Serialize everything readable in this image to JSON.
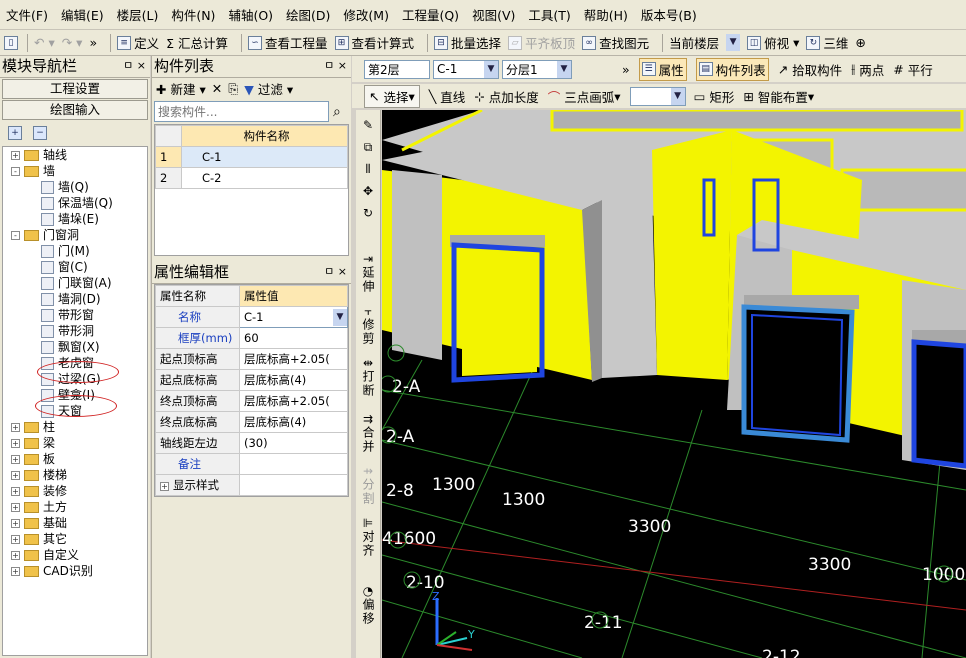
{
  "menu": [
    "文件(F)",
    "编辑(E)",
    "楼层(L)",
    "构件(N)",
    "辅轴(O)",
    "绘图(D)",
    "修改(M)",
    "工程量(Q)",
    "视图(V)",
    "工具(T)",
    "帮助(H)",
    "版本号(B)"
  ],
  "toolbar": {
    "define": "定义",
    "summary": "Σ 汇总计算",
    "view_qty": "查看工程量",
    "view_formula": "查看计算式",
    "batch_select": "批量选择",
    "align_slab": "平齐板顶",
    "find_elem": "查找图元",
    "cur_floor": "当前楼层",
    "view_mode": "俯视",
    "view_3d": "三维"
  },
  "nav": {
    "title": "模块导航栏",
    "pin": "ㅁ ×",
    "btn1": "工程设置",
    "btn2": "绘图输入",
    "tree": [
      {
        "label": "轴线",
        "level": 0,
        "type": "folder",
        "pm": "+"
      },
      {
        "label": "墙",
        "level": 0,
        "type": "folder",
        "pm": "-"
      },
      {
        "label": "墙(Q)",
        "level": 1,
        "type": "item"
      },
      {
        "label": "保温墙(Q)",
        "level": 1,
        "type": "item"
      },
      {
        "label": "墙垛(E)",
        "level": 1,
        "type": "item"
      },
      {
        "label": "门窗洞",
        "level": 0,
        "type": "folder",
        "pm": "-"
      },
      {
        "label": "门(M)",
        "level": 1,
        "type": "item"
      },
      {
        "label": "窗(C)",
        "level": 1,
        "type": "item"
      },
      {
        "label": "门联窗(A)",
        "level": 1,
        "type": "item"
      },
      {
        "label": "墙洞(D)",
        "level": 1,
        "type": "item"
      },
      {
        "label": "带形窗",
        "level": 1,
        "type": "item"
      },
      {
        "label": "带形洞",
        "level": 1,
        "type": "item"
      },
      {
        "label": "飘窗(X)",
        "level": 1,
        "type": "item"
      },
      {
        "label": "老虎窗",
        "level": 1,
        "type": "item"
      },
      {
        "label": "过梁(G)",
        "level": 1,
        "type": "item"
      },
      {
        "label": "壁龛(I)",
        "level": 1,
        "type": "item"
      },
      {
        "label": "天窗",
        "level": 1,
        "type": "item"
      },
      {
        "label": "柱",
        "level": 0,
        "type": "folder",
        "pm": "+"
      },
      {
        "label": "梁",
        "level": 0,
        "type": "folder",
        "pm": "+"
      },
      {
        "label": "板",
        "level": 0,
        "type": "folder",
        "pm": "+"
      },
      {
        "label": "楼梯",
        "level": 0,
        "type": "folder",
        "pm": "+"
      },
      {
        "label": "装修",
        "level": 0,
        "type": "folder",
        "pm": "+"
      },
      {
        "label": "土方",
        "level": 0,
        "type": "folder",
        "pm": "+"
      },
      {
        "label": "基础",
        "level": 0,
        "type": "folder",
        "pm": "+"
      },
      {
        "label": "其它",
        "level": 0,
        "type": "folder",
        "pm": "+"
      },
      {
        "label": "自定义",
        "level": 0,
        "type": "folder",
        "pm": "+"
      },
      {
        "label": "CAD识别",
        "level": 0,
        "type": "folder",
        "pm": "+"
      }
    ]
  },
  "comp": {
    "title": "构件列表",
    "new": "新建",
    "filter": "过滤",
    "search_placeholder": "搜索构件...",
    "col": "构件名称",
    "rows": [
      {
        "no": "1",
        "name": "C-1"
      },
      {
        "no": "2",
        "name": "C-2"
      }
    ]
  },
  "props": {
    "title": "属性编辑框",
    "h1": "属性名称",
    "h2": "属性值",
    "rows": [
      {
        "name": "名称",
        "value": "C-1",
        "blue": true
      },
      {
        "name": "框厚(mm)",
        "value": "60",
        "blue": true
      },
      {
        "name": "起点顶标高",
        "value": "层底标高+2.05(",
        "blue": false
      },
      {
        "name": "起点底标高",
        "value": "层底标高(4)",
        "blue": false
      },
      {
        "name": "终点顶标高",
        "value": "层底标高+2.05(",
        "blue": false
      },
      {
        "name": "终点底标高",
        "value": "层底标高(4)",
        "blue": false
      },
      {
        "name": "轴线距左边",
        "value": "(30)",
        "blue": false
      },
      {
        "name": "备注",
        "value": "",
        "blue": true
      },
      {
        "name": "显示样式",
        "value": "",
        "blue": false,
        "expand": "+"
      }
    ]
  },
  "cad": {
    "floor": "第2层",
    "comp": "C-1",
    "layer": "分层1",
    "attr": "属性",
    "complist": "构件列表",
    "pick": "拾取构件",
    "two_pt": "两点",
    "parallel": "平行",
    "select": "选择",
    "line": "直线",
    "pt_len": "点加长度",
    "arc3": "三点画弧",
    "rect": "矩形",
    "smart": "智能布置"
  },
  "vtools": [
    "延伸",
    "修剪",
    "打断",
    "合并",
    "分割",
    "对齐",
    "偏移"
  ],
  "canvas_labels": [
    "2-A",
    "2-A",
    "2-8",
    "1300",
    "1300",
    "3300",
    "3300",
    "1000",
    "41600",
    "2-10",
    "2-11",
    "2-12"
  ],
  "colors": {
    "wall_yellow": "#f3f400",
    "floor_gray": "#c8c8c8",
    "canvas_bg": "#000000",
    "window_blue": "#1f45e0"
  }
}
